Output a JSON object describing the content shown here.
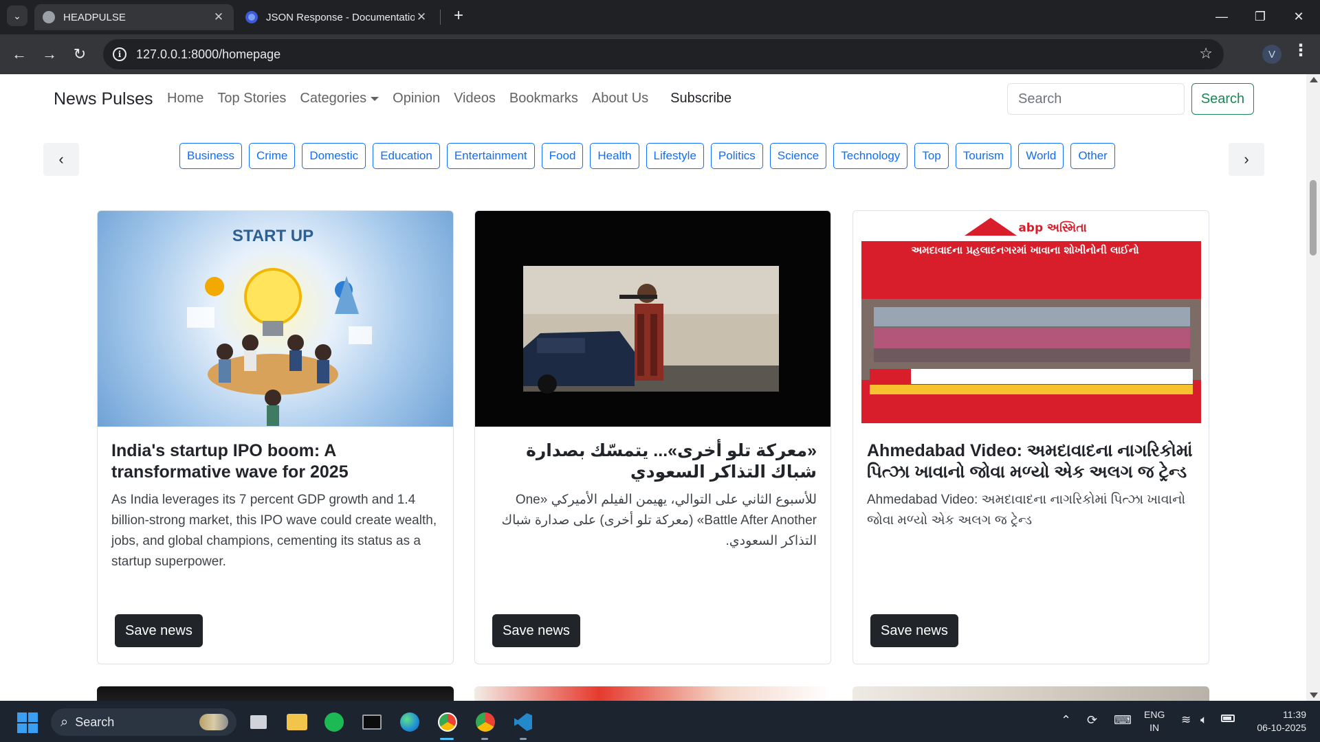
{
  "browser": {
    "tabs": [
      {
        "title": "HEADPULSE",
        "active": true
      },
      {
        "title": "JSON Response - Documentation",
        "active": false
      }
    ],
    "url": "127.0.0.1:8000/homepage",
    "profile_initial": "V"
  },
  "site": {
    "brand": "News Pulses",
    "nav": [
      "Home",
      "Top Stories",
      "Categories",
      "Opinion",
      "Videos",
      "Bookmarks",
      "About Us",
      "Subscribe"
    ],
    "search": {
      "placeholder": "Search",
      "button": "Search"
    },
    "categories": [
      "Business",
      "Crime",
      "Domestic",
      "Education",
      "Entertainment",
      "Food",
      "Health",
      "Lifestyle",
      "Politics",
      "Science",
      "Technology",
      "Top",
      "Tourism",
      "World",
      "Other"
    ]
  },
  "cards": [
    {
      "title": "India's startup IPO boom: A transformative wave for 2025",
      "description": "As India leverages its 7 percent GDP growth and 1.4 billion-strong market, this IPO wave could create wealth, jobs, and global champions, cementing its status as a startup superpower.",
      "image_text": "START UP",
      "button": "Save news"
    },
    {
      "title": "«معركة تلو أخرى»... يتمسّك بصدارة شباك التذاكر السعودي",
      "description": "للأسبوع الثاني على التوالي، يهيمن الفيلم الأميركي «One Battle After Another» (معركة تلو أخرى) على صدارة شباك التذاكر السعودي.",
      "button": "Save news"
    },
    {
      "title": "Ahmedabad Video: અમદાવાદના નાગરિકોમાં પિત્ઝા ખાવાનો જોવા મળ્યો એક અલગ જ ટ્રેન્ડ",
      "description": "Ahmedabad Video: અમદાવાદના નાગરિકોમાં પિત્ઝા ખાવાનો જોવા મળ્યો એક અલગ જ ટ્રેન્ડ",
      "image_logo": "abp અસ્મિતા",
      "image_headline": "અમદાવાદના પ્રહલાદનગરમાં ખાવાના શોખીનોની લાઈનો",
      "button": "Save news"
    }
  ],
  "taskbar": {
    "search": "Search",
    "lang_line1": "ENG",
    "lang_line2": "IN",
    "time": "11:39",
    "date": "06-10-2025"
  },
  "colors": {
    "primary": "#0d6efd",
    "success": "#198754",
    "dark": "#212529",
    "chrome_bg": "#202124",
    "chrome_toolbar": "#35363a"
  }
}
